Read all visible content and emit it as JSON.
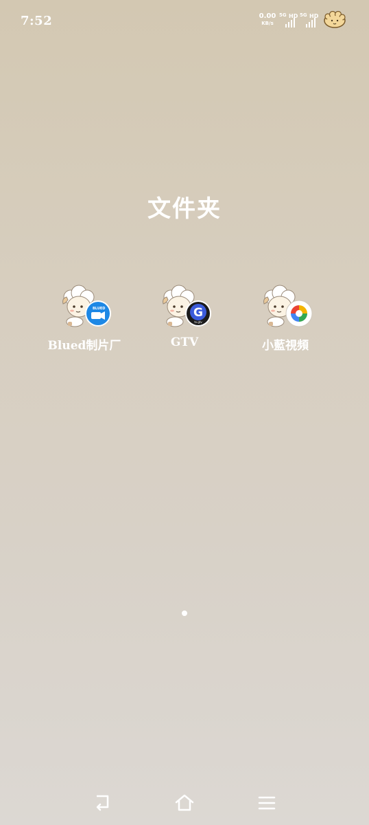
{
  "status_bar": {
    "time": "7:52",
    "net_speed_value": "0.00",
    "net_speed_unit": "KB/s",
    "sim1": {
      "network": "5G",
      "label": "HD"
    },
    "sim2": {
      "network": "5G",
      "label": "HD"
    },
    "battery_icon": "sheep-battery-icon"
  },
  "folder": {
    "title": "文件夹",
    "apps": [
      {
        "label": "Blued制片厂",
        "icon": "sheep-blue-camera-icon",
        "badge_text": "BLUED 制片厂"
      },
      {
        "label": "GTV",
        "icon": "sheep-gtv-icon",
        "badge_text": "G"
      },
      {
        "label": "小藍視頻",
        "icon": "sheep-colorful-circle-icon",
        "badge_text": ""
      }
    ]
  },
  "pager": {
    "current_page": 1,
    "total_pages": 1
  },
  "nav": {
    "back_icon": "back-icon",
    "home_icon": "home-icon",
    "menu_icon": "menu-icon"
  },
  "colors": {
    "text": "#ffffff",
    "background_top": "#d3c8b2",
    "background_bottom": "#dcd8d3",
    "blued_blue": "#1e88e5",
    "gtv_dark": "#1b1b1b"
  }
}
